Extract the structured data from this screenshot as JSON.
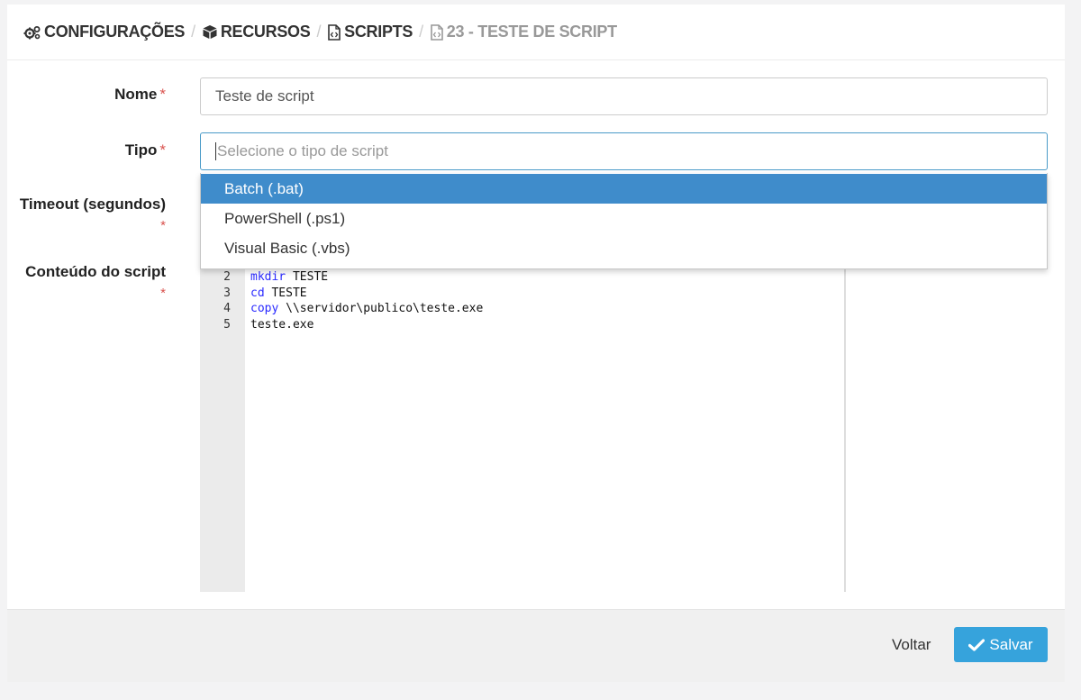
{
  "breadcrumb": {
    "items": [
      {
        "label": "CONFIGURAÇÕES",
        "icon": "gears-icon"
      },
      {
        "label": "RECURSOS",
        "icon": "cube-icon"
      },
      {
        "label": "SCRIPTS",
        "icon": "file-code-icon"
      },
      {
        "label": "23 - TESTE DE SCRIPT",
        "icon": "file-code-icon"
      }
    ],
    "separator": "/"
  },
  "form": {
    "nome": {
      "label": "Nome",
      "required_mark": "*",
      "value": "Teste de script"
    },
    "tipo": {
      "label": "Tipo",
      "required_mark": "*",
      "placeholder": "Selecione o tipo de script"
    },
    "timeout": {
      "label": "Timeout (segundos)",
      "required_mark": "*"
    },
    "conteudo": {
      "label": "Conteúdo do script",
      "required_mark": "*"
    }
  },
  "dropdown": {
    "options": [
      "Batch (.bat)",
      "PowerShell (.ps1)",
      "Visual Basic (.vbs)"
    ],
    "highlighted": "Batch (.bat)"
  },
  "editor": {
    "lines": [
      {
        "n": "2",
        "keyword": "mkdir",
        "rest": " TESTE"
      },
      {
        "n": "3",
        "keyword": "cd",
        "rest": " TESTE"
      },
      {
        "n": "4",
        "keyword": "copy",
        "rest": " \\\\servidor\\publico\\teste.exe"
      },
      {
        "n": "5",
        "keyword": "",
        "rest": "teste.exe"
      }
    ]
  },
  "footer": {
    "back_label": "Voltar",
    "save_label": "Salvar"
  },
  "colors": {
    "accent": "#36a3dc",
    "selected_option": "#3f8ccb",
    "required": "#d9534f"
  }
}
